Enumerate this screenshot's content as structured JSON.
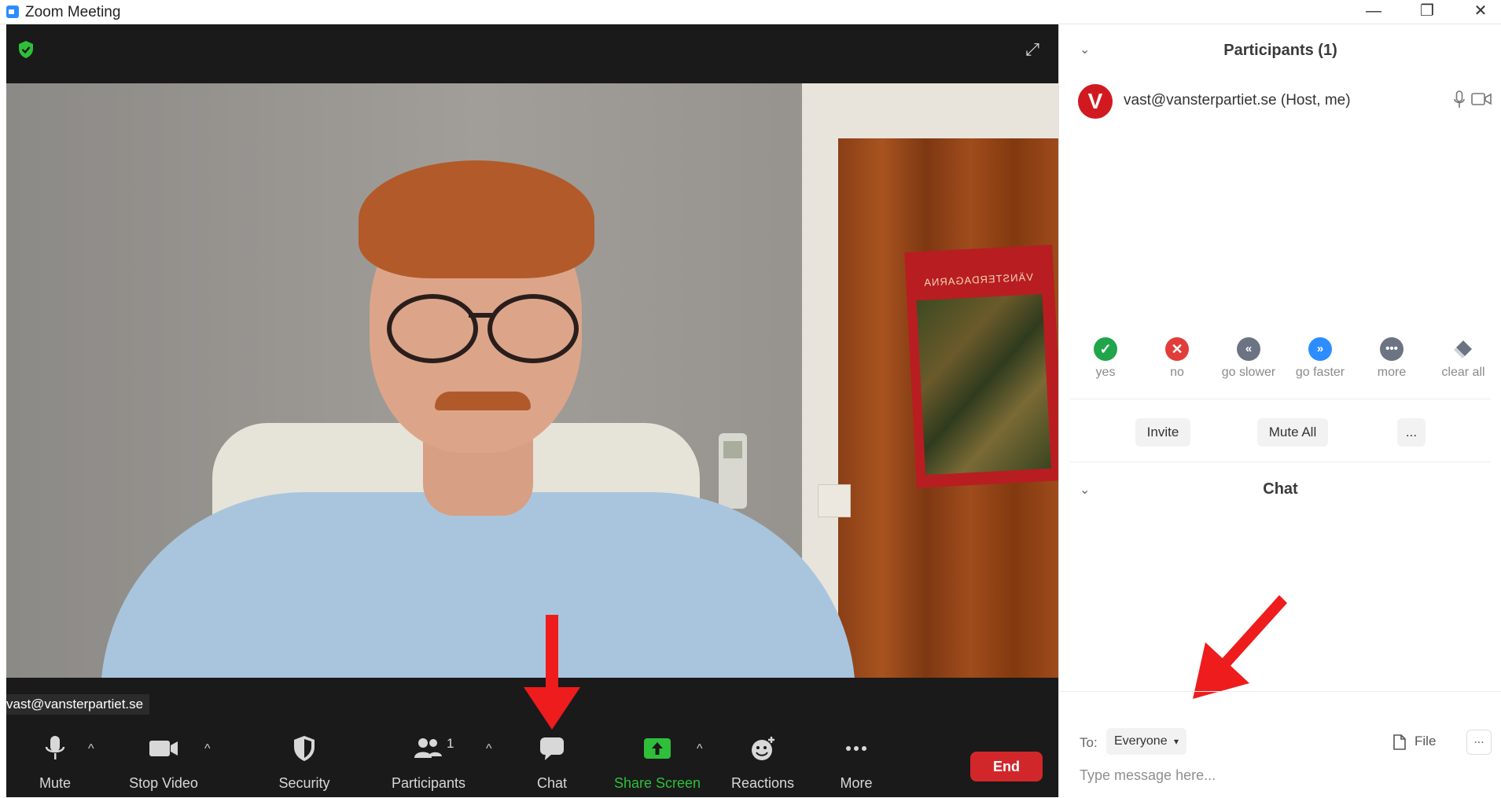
{
  "window": {
    "title": "Zoom Meeting",
    "minimize": "—",
    "maximize": "❐",
    "close": "✕"
  },
  "video": {
    "self_name": "vast@vansterpartiet.se",
    "poster_text": "VÄNSTERDAGARNA",
    "toolbar": {
      "mute": "Mute",
      "stop_video": "Stop Video",
      "security": "Security",
      "participants": "Participants",
      "participants_count": "1",
      "chat": "Chat",
      "share_screen": "Share Screen",
      "reactions": "Reactions",
      "more": "More",
      "end": "End"
    }
  },
  "participants_panel": {
    "title": "Participants (1)",
    "participant": {
      "initial": "V",
      "name": "vast@vansterpartiet.se (Host, me)"
    },
    "reactions": [
      {
        "label": "yes",
        "icon": "check-icon",
        "color": "#21a54a"
      },
      {
        "label": "no",
        "icon": "x-icon",
        "color": "#e23d3a"
      },
      {
        "label": "go slower",
        "icon": "rewind-icon",
        "color": "#6c7383"
      },
      {
        "label": "go faster",
        "icon": "fast-forward-icon",
        "color": "#2d8cff"
      },
      {
        "label": "more",
        "icon": "ellipsis-icon",
        "color": "#6c7383"
      },
      {
        "label": "clear all",
        "icon": "eraser-icon",
        "color": "#6c7383"
      }
    ],
    "buttons": {
      "invite": "Invite",
      "mute_all": "Mute All",
      "more": "..."
    }
  },
  "chat_panel": {
    "title": "Chat",
    "to_label": "To:",
    "to_value": "Everyone",
    "file_label": "File",
    "more": "...",
    "placeholder": "Type message here..."
  },
  "colors": {
    "end_button": "#d2272a",
    "share_screen": "#2fbf3a",
    "accent": "#2d8cff"
  }
}
